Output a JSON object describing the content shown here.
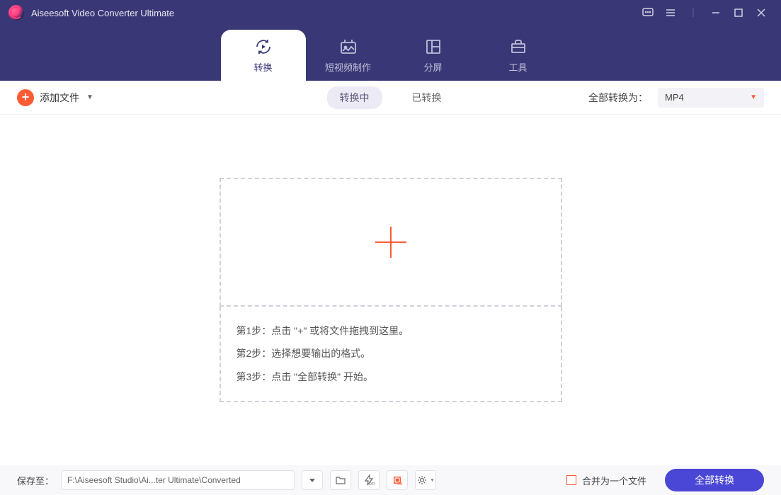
{
  "title": "Aiseesoft Video Converter Ultimate",
  "nav": {
    "tabs": [
      {
        "label": "转换",
        "active": true
      },
      {
        "label": "短视频制作",
        "active": false
      },
      {
        "label": "分屏",
        "active": false
      },
      {
        "label": "工具",
        "active": false
      }
    ]
  },
  "toolbar": {
    "add_file": "添加文件",
    "sub_tabs": {
      "converting": "转换中",
      "converted": "已转换"
    },
    "convert_all_to": "全部转换为：",
    "format": "MP4"
  },
  "steps": {
    "s1": "第1步：点击 \"+\" 或将文件拖拽到这里。",
    "s2": "第2步：选择想要输出的格式。",
    "s3": "第3步：点击 \"全部转换\" 开始。"
  },
  "bottom": {
    "save_to": "保存至：",
    "path": "F:\\Aiseesoft Studio\\Ai...ter Ultimate\\Converted",
    "merge": "合并为一个文件",
    "convert_all": "全部转换"
  }
}
